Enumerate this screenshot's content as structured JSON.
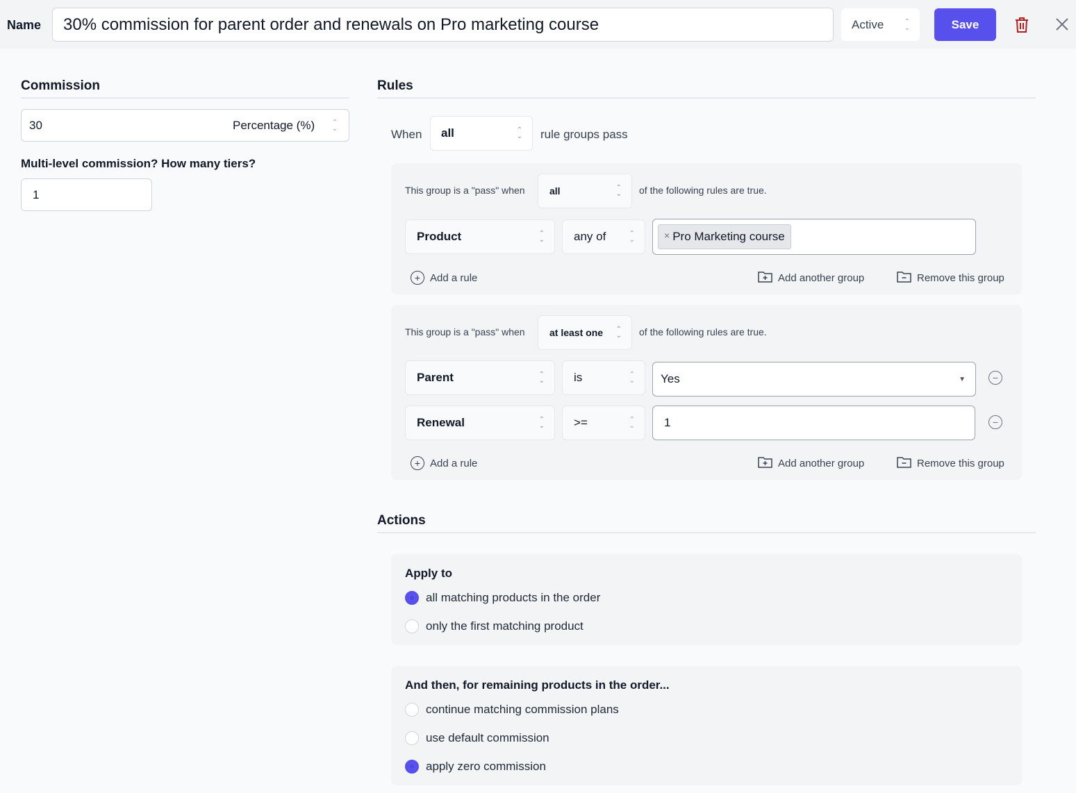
{
  "header": {
    "name_label": "Name",
    "name_value": "30% commission for parent order and renewals on Pro marketing course",
    "status": "Active",
    "save_label": "Save"
  },
  "commission": {
    "title": "Commission",
    "amount": "30",
    "type": "Percentage (%)",
    "tiers_label": "Multi-level commission? How many tiers?",
    "tiers": "1"
  },
  "rules": {
    "title": "Rules",
    "when": "When",
    "when_value": "all",
    "when_suffix": "rule groups pass",
    "groups": [
      {
        "prefix": "This group is a \"pass\" when",
        "mode": "all",
        "suffix": "of the following rules are true.",
        "rules": [
          {
            "field": "Product",
            "op": "any of",
            "tag": "Pro Marketing course"
          }
        ],
        "add_rule": "Add a rule",
        "add_group": "Add another group",
        "remove_group": "Remove this group"
      },
      {
        "prefix": "This group is a \"pass\" when",
        "mode": "at least one",
        "suffix": "of the following rules are true.",
        "rules": [
          {
            "field": "Parent",
            "op": "is",
            "value": "Yes"
          },
          {
            "field": "Renewal",
            "op": ">=",
            "value": "1"
          }
        ],
        "add_rule": "Add a rule",
        "add_group": "Add another group",
        "remove_group": "Remove this group"
      }
    ]
  },
  "actions": {
    "title": "Actions",
    "apply_title": "Apply to",
    "apply_options": [
      "all matching products in the order",
      "only the first matching product"
    ],
    "apply_selected": 0,
    "then_title": "And then, for remaining products in the order...",
    "then_options": [
      "continue matching commission plans",
      "use default commission",
      "apply zero commission"
    ],
    "then_selected": 2
  },
  "colors": {
    "accent": "#5850ec",
    "delete": "#b91c1c"
  }
}
